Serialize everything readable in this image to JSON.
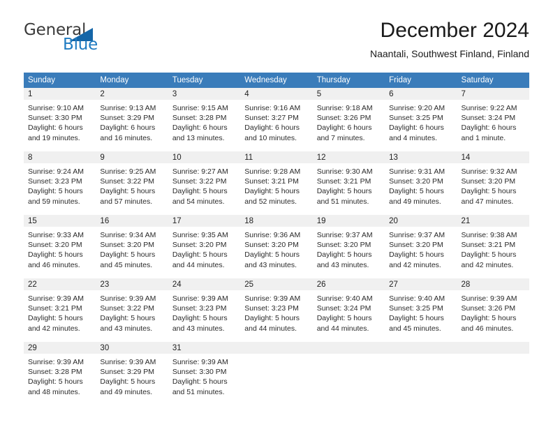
{
  "brand": {
    "name_part1": "General",
    "name_part2": "Blue",
    "triangle_color": "#1566a8",
    "blue_color": "#1f7bc1"
  },
  "header": {
    "title": "December 2024",
    "subtitle": "Naantali, Southwest Finland, Finland"
  },
  "theme": {
    "header_bg": "#3a7cba",
    "divider": "#2f6fae",
    "date_band_bg": "#f0f0f0"
  },
  "calendar": {
    "weekday_headers": [
      "Sunday",
      "Monday",
      "Tuesday",
      "Wednesday",
      "Thursday",
      "Friday",
      "Saturday"
    ],
    "weeks": [
      [
        {
          "date": "1",
          "sunrise": "Sunrise: 9:10 AM",
          "sunset": "Sunset: 3:30 PM",
          "daylight1": "Daylight: 6 hours",
          "daylight2": "and 19 minutes."
        },
        {
          "date": "2",
          "sunrise": "Sunrise: 9:13 AM",
          "sunset": "Sunset: 3:29 PM",
          "daylight1": "Daylight: 6 hours",
          "daylight2": "and 16 minutes."
        },
        {
          "date": "3",
          "sunrise": "Sunrise: 9:15 AM",
          "sunset": "Sunset: 3:28 PM",
          "daylight1": "Daylight: 6 hours",
          "daylight2": "and 13 minutes."
        },
        {
          "date": "4",
          "sunrise": "Sunrise: 9:16 AM",
          "sunset": "Sunset: 3:27 PM",
          "daylight1": "Daylight: 6 hours",
          "daylight2": "and 10 minutes."
        },
        {
          "date": "5",
          "sunrise": "Sunrise: 9:18 AM",
          "sunset": "Sunset: 3:26 PM",
          "daylight1": "Daylight: 6 hours",
          "daylight2": "and 7 minutes."
        },
        {
          "date": "6",
          "sunrise": "Sunrise: 9:20 AM",
          "sunset": "Sunset: 3:25 PM",
          "daylight1": "Daylight: 6 hours",
          "daylight2": "and 4 minutes."
        },
        {
          "date": "7",
          "sunrise": "Sunrise: 9:22 AM",
          "sunset": "Sunset: 3:24 PM",
          "daylight1": "Daylight: 6 hours",
          "daylight2": "and 1 minute."
        }
      ],
      [
        {
          "date": "8",
          "sunrise": "Sunrise: 9:24 AM",
          "sunset": "Sunset: 3:23 PM",
          "daylight1": "Daylight: 5 hours",
          "daylight2": "and 59 minutes."
        },
        {
          "date": "9",
          "sunrise": "Sunrise: 9:25 AM",
          "sunset": "Sunset: 3:22 PM",
          "daylight1": "Daylight: 5 hours",
          "daylight2": "and 57 minutes."
        },
        {
          "date": "10",
          "sunrise": "Sunrise: 9:27 AM",
          "sunset": "Sunset: 3:22 PM",
          "daylight1": "Daylight: 5 hours",
          "daylight2": "and 54 minutes."
        },
        {
          "date": "11",
          "sunrise": "Sunrise: 9:28 AM",
          "sunset": "Sunset: 3:21 PM",
          "daylight1": "Daylight: 5 hours",
          "daylight2": "and 52 minutes."
        },
        {
          "date": "12",
          "sunrise": "Sunrise: 9:30 AM",
          "sunset": "Sunset: 3:21 PM",
          "daylight1": "Daylight: 5 hours",
          "daylight2": "and 51 minutes."
        },
        {
          "date": "13",
          "sunrise": "Sunrise: 9:31 AM",
          "sunset": "Sunset: 3:20 PM",
          "daylight1": "Daylight: 5 hours",
          "daylight2": "and 49 minutes."
        },
        {
          "date": "14",
          "sunrise": "Sunrise: 9:32 AM",
          "sunset": "Sunset: 3:20 PM",
          "daylight1": "Daylight: 5 hours",
          "daylight2": "and 47 minutes."
        }
      ],
      [
        {
          "date": "15",
          "sunrise": "Sunrise: 9:33 AM",
          "sunset": "Sunset: 3:20 PM",
          "daylight1": "Daylight: 5 hours",
          "daylight2": "and 46 minutes."
        },
        {
          "date": "16",
          "sunrise": "Sunrise: 9:34 AM",
          "sunset": "Sunset: 3:20 PM",
          "daylight1": "Daylight: 5 hours",
          "daylight2": "and 45 minutes."
        },
        {
          "date": "17",
          "sunrise": "Sunrise: 9:35 AM",
          "sunset": "Sunset: 3:20 PM",
          "daylight1": "Daylight: 5 hours",
          "daylight2": "and 44 minutes."
        },
        {
          "date": "18",
          "sunrise": "Sunrise: 9:36 AM",
          "sunset": "Sunset: 3:20 PM",
          "daylight1": "Daylight: 5 hours",
          "daylight2": "and 43 minutes."
        },
        {
          "date": "19",
          "sunrise": "Sunrise: 9:37 AM",
          "sunset": "Sunset: 3:20 PM",
          "daylight1": "Daylight: 5 hours",
          "daylight2": "and 43 minutes."
        },
        {
          "date": "20",
          "sunrise": "Sunrise: 9:37 AM",
          "sunset": "Sunset: 3:20 PM",
          "daylight1": "Daylight: 5 hours",
          "daylight2": "and 42 minutes."
        },
        {
          "date": "21",
          "sunrise": "Sunrise: 9:38 AM",
          "sunset": "Sunset: 3:21 PM",
          "daylight1": "Daylight: 5 hours",
          "daylight2": "and 42 minutes."
        }
      ],
      [
        {
          "date": "22",
          "sunrise": "Sunrise: 9:39 AM",
          "sunset": "Sunset: 3:21 PM",
          "daylight1": "Daylight: 5 hours",
          "daylight2": "and 42 minutes."
        },
        {
          "date": "23",
          "sunrise": "Sunrise: 9:39 AM",
          "sunset": "Sunset: 3:22 PM",
          "daylight1": "Daylight: 5 hours",
          "daylight2": "and 43 minutes."
        },
        {
          "date": "24",
          "sunrise": "Sunrise: 9:39 AM",
          "sunset": "Sunset: 3:23 PM",
          "daylight1": "Daylight: 5 hours",
          "daylight2": "and 43 minutes."
        },
        {
          "date": "25",
          "sunrise": "Sunrise: 9:39 AM",
          "sunset": "Sunset: 3:23 PM",
          "daylight1": "Daylight: 5 hours",
          "daylight2": "and 44 minutes."
        },
        {
          "date": "26",
          "sunrise": "Sunrise: 9:40 AM",
          "sunset": "Sunset: 3:24 PM",
          "daylight1": "Daylight: 5 hours",
          "daylight2": "and 44 minutes."
        },
        {
          "date": "27",
          "sunrise": "Sunrise: 9:40 AM",
          "sunset": "Sunset: 3:25 PM",
          "daylight1": "Daylight: 5 hours",
          "daylight2": "and 45 minutes."
        },
        {
          "date": "28",
          "sunrise": "Sunrise: 9:39 AM",
          "sunset": "Sunset: 3:26 PM",
          "daylight1": "Daylight: 5 hours",
          "daylight2": "and 46 minutes."
        }
      ],
      [
        {
          "date": "29",
          "sunrise": "Sunrise: 9:39 AM",
          "sunset": "Sunset: 3:28 PM",
          "daylight1": "Daylight: 5 hours",
          "daylight2": "and 48 minutes."
        },
        {
          "date": "30",
          "sunrise": "Sunrise: 9:39 AM",
          "sunset": "Sunset: 3:29 PM",
          "daylight1": "Daylight: 5 hours",
          "daylight2": "and 49 minutes."
        },
        {
          "date": "31",
          "sunrise": "Sunrise: 9:39 AM",
          "sunset": "Sunset: 3:30 PM",
          "daylight1": "Daylight: 5 hours",
          "daylight2": "and 51 minutes."
        },
        {
          "date": "",
          "sunrise": "",
          "sunset": "",
          "daylight1": "",
          "daylight2": ""
        },
        {
          "date": "",
          "sunrise": "",
          "sunset": "",
          "daylight1": "",
          "daylight2": ""
        },
        {
          "date": "",
          "sunrise": "",
          "sunset": "",
          "daylight1": "",
          "daylight2": ""
        },
        {
          "date": "",
          "sunrise": "",
          "sunset": "",
          "daylight1": "",
          "daylight2": ""
        }
      ]
    ]
  }
}
